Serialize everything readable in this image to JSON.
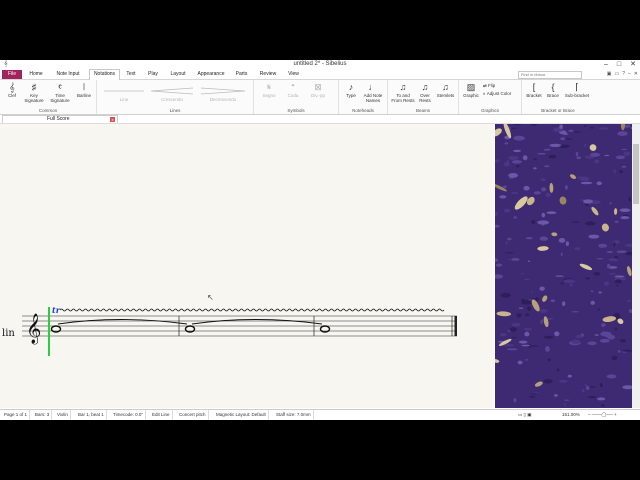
{
  "window": {
    "title": "untitled 2* - Sibelius"
  },
  "tabs": [
    {
      "label": "File"
    },
    {
      "label": "Home"
    },
    {
      "label": "Note Input"
    },
    {
      "label": "Notations"
    },
    {
      "label": "Text"
    },
    {
      "label": "Play"
    },
    {
      "label": "Layout"
    },
    {
      "label": "Appearance"
    },
    {
      "label": "Parts"
    },
    {
      "label": "Review"
    },
    {
      "label": "View"
    }
  ],
  "search": {
    "placeholder": "Find in ribbon"
  },
  "ribbon": {
    "common": {
      "label": "Common",
      "clef": "Clef",
      "key": "Key\nSignature",
      "time": "Time\nSignature",
      "barline": "Barline"
    },
    "lines": {
      "label": "Lines",
      "line": "Line",
      "crescendo": "Crescendo",
      "decrescendo": "Decrescendo"
    },
    "symbols": {
      "label": "Symbols",
      "segno": "Segno",
      "coda": "Coda",
      "divs": "Div.-pp"
    },
    "noteheads": {
      "label": "Noteheads",
      "type": "Type",
      "add_note_names": "Add Note\nNames"
    },
    "beams": {
      "label": "Beams",
      "to_from_rests": "To and\nFrom Rests",
      "over_rests": "Over\nRests",
      "stemlets": "Stemlets"
    },
    "graphics": {
      "label": "Graphics",
      "graphic": "Graphic",
      "flip": "Flip",
      "adjust_color": "Adjust Color"
    },
    "bracket": {
      "label": "Bracket or Brace",
      "bracket": "Bracket",
      "brace": "Brace",
      "sub_bracket": "Sub-bracket"
    }
  },
  "doc_tab": {
    "label": "Full Score",
    "close": "x"
  },
  "score": {
    "instrument": "lin",
    "trill": "tr"
  },
  "status": {
    "page": "Page 1 of 1",
    "bars": "Bars: 3",
    "instrument": "Violin",
    "position": "Bar 1, beat 1",
    "timecode": "Timecode: 0.0\"",
    "mode": "Edit Line",
    "pitch": "Concert pitch",
    "layout": "Magnetic Layout: Default",
    "staff_size": "Staff size: 7.0mm",
    "zoom": "151.00%"
  },
  "colors": {
    "file_tab": "#a0255e",
    "keypad_base": "#3d2a73",
    "selection_cursor": "#2ecc40"
  },
  "icons": [
    "clef-icon",
    "key-signature-icon",
    "time-signature-icon",
    "barline-icon",
    "segno-icon",
    "coda-icon",
    "notehead-type-icon",
    "add-note-names-icon",
    "beam-icon",
    "graphic-icon",
    "bracket-icon",
    "brace-icon",
    "sub-bracket-icon",
    "save-icon",
    "minimize-icon",
    "maximize-icon",
    "close-icon"
  ]
}
